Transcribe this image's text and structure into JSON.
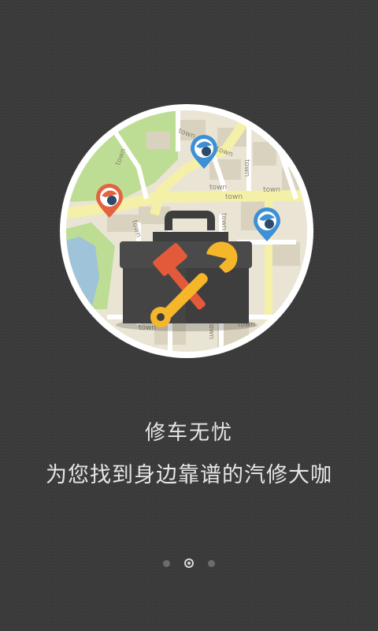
{
  "illustration": {
    "map_street_label": "town",
    "colors": {
      "map_background": "#eae4d5",
      "road": "#f5f0a8",
      "park": "#bedd94",
      "water": "#9fc3d8",
      "toolbox": "#3e3e3e",
      "hammer": "#e35a3b",
      "wrench": "#f5b62a",
      "pin_blue": "#3d8fd6",
      "pin_red": "#e36240"
    }
  },
  "onboarding": {
    "title": "修车无忧",
    "subtitle": "为您找到身边靠谱的汽修大咖"
  },
  "pager": {
    "total": 3,
    "current": 2
  }
}
